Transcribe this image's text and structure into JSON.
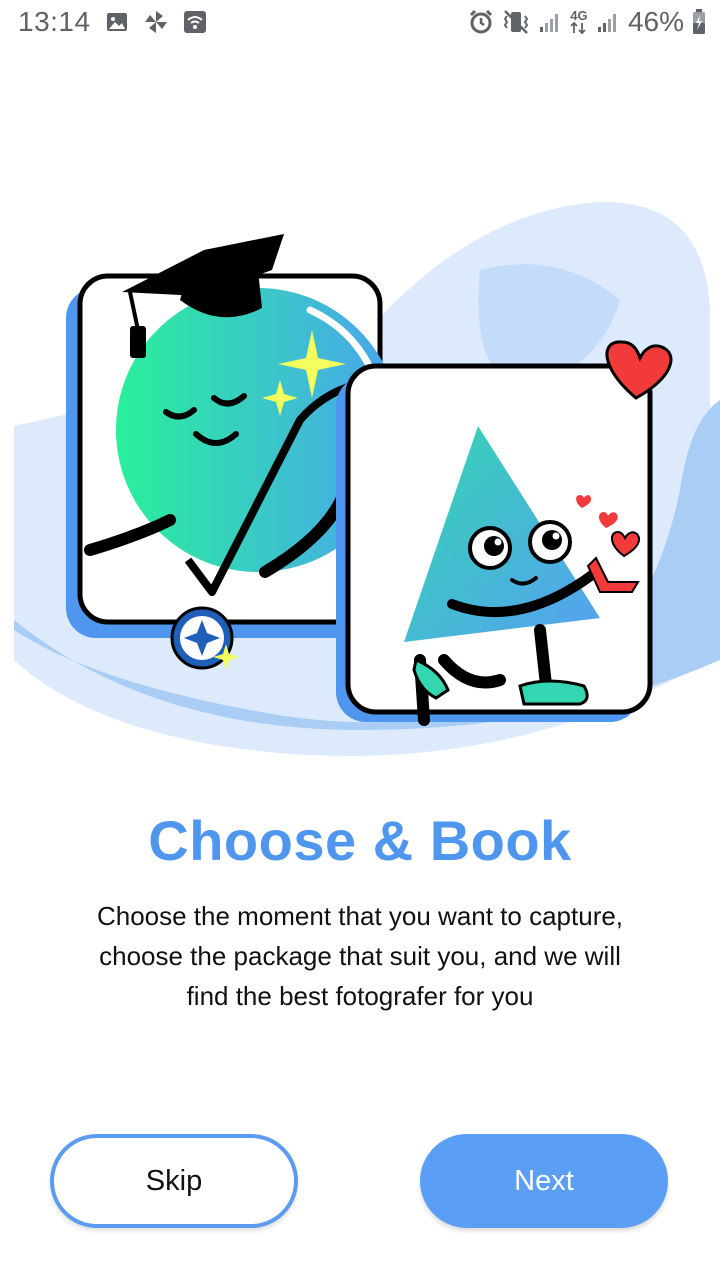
{
  "status_bar": {
    "time": "13:14",
    "battery": "46%",
    "network": "4G",
    "icons": [
      "image-icon",
      "pinwheel-icon",
      "wifi-icon",
      "alarm-icon",
      "vibrate-icon",
      "signal-icon",
      "signal-icon",
      "battery-icon"
    ]
  },
  "onboarding": {
    "illustration": "graduation-and-proposal-illustration",
    "title": "Choose & Book",
    "description": "Choose the moment that you want to capture, choose the package that suit you, and we will find the best fotografer for you"
  },
  "actions": {
    "skip_label": "Skip",
    "next_label": "Next"
  },
  "colors": {
    "accent": "#4f96ee",
    "button_fill": "#5b9ef5",
    "button_outline": "#5b9cf0"
  }
}
